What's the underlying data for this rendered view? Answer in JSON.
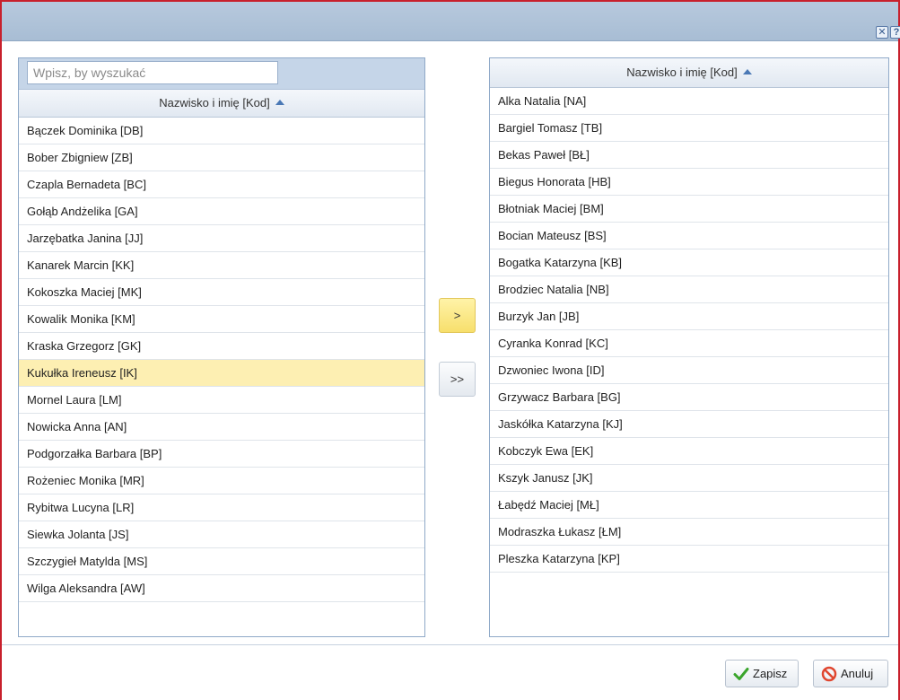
{
  "dialog": {
    "close_icon": "close-icon",
    "close_label": "✕",
    "help_icon": "help-icon",
    "help_label": "?"
  },
  "left": {
    "search_placeholder": "Wpisz, by wyszukać",
    "header": "Nazwisko i imię [Kod]",
    "sort": "ascending",
    "items": [
      "Bączek Dominika [DB]",
      "Bober Zbigniew [ZB]",
      "Czapla Bernadeta [BC]",
      "Gołąb Andżelika [GA]",
      "Jarzębatka Janina [JJ]",
      "Kanarek Marcin [KK]",
      "Kokoszka Maciej [MK]",
      "Kowalik Monika [KM]",
      "Kraska Grzegorz [GK]",
      "Kukułka Ireneusz [IK]",
      "Mornel Laura [LM]",
      "Nowicka Anna [AN]",
      "Podgorzałka Barbara [BP]",
      "Rożeniec Monika [MR]",
      "Rybitwa Lucyna [LR]",
      "Siewka Jolanta [JS]",
      "Szczygieł Matylda [MS]",
      "Wilga Aleksandra [AW]"
    ],
    "selected_index": 9
  },
  "transfer": {
    "move_one_label": ">",
    "move_all_label": ">>"
  },
  "right": {
    "header": "Nazwisko i imię [Kod]",
    "sort": "ascending",
    "items": [
      "Alka Natalia [NA]",
      "Bargiel Tomasz [TB]",
      "Bekas Paweł [BŁ]",
      "Biegus Honorata [HB]",
      "Błotniak Maciej [BM]",
      "Bocian Mateusz [BS]",
      "Bogatka Katarzyna [KB]",
      "Brodziec Natalia [NB]",
      "Burzyk Jan [JB]",
      "Cyranka Konrad [KC]",
      "Dzwoniec Iwona [ID]",
      "Grzywacz Barbara [BG]",
      "Jaskółka Katarzyna [KJ]",
      "Kobczyk Ewa [EK]",
      "Kszyk Janusz [JK]",
      "Łabędź Maciej [MŁ]",
      "Modraszka Łukasz [ŁM]",
      "Pleszka Katarzyna [KP]"
    ]
  },
  "footer": {
    "save_label": "Zapisz",
    "save_icon": "checkmark-icon",
    "cancel_label": "Anuluj",
    "cancel_icon": "cancel-icon"
  },
  "colors": {
    "selected_row": "#fdefb2",
    "active_button": "#f7df6c",
    "titlebar": "#aec2d8",
    "sort_arrow": "#4a78b5",
    "save_icon": "#3aa52c",
    "cancel_icon": "#e0462f"
  }
}
